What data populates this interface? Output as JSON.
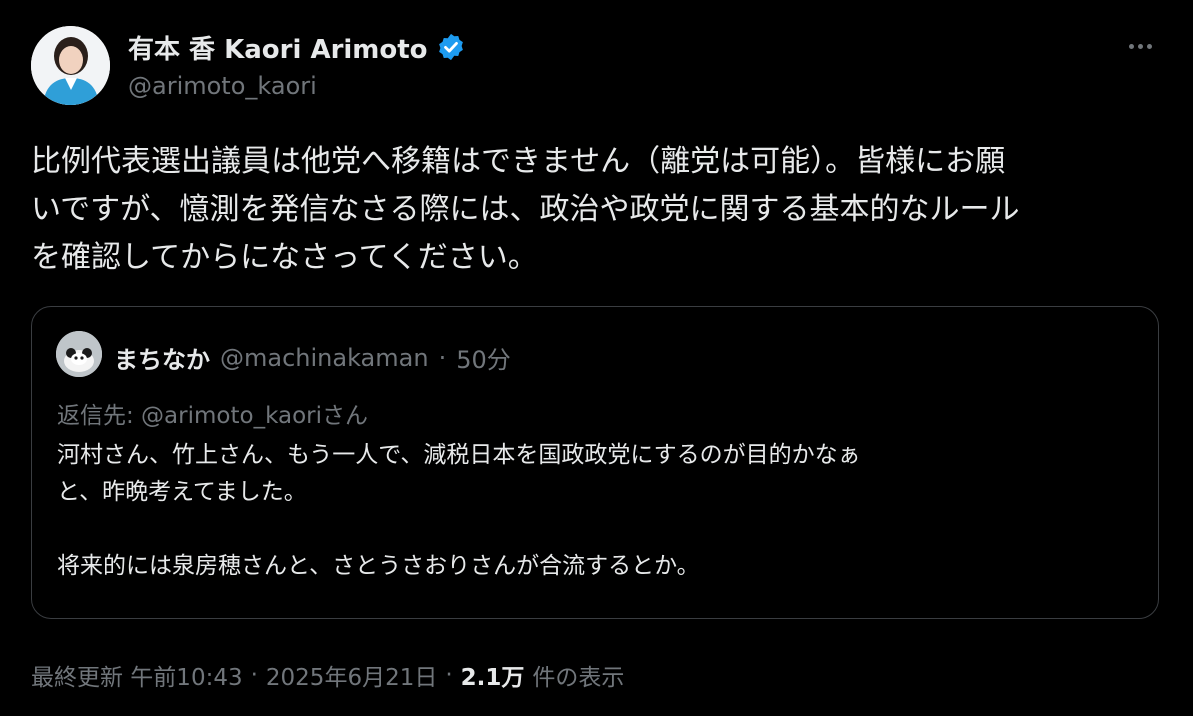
{
  "author": {
    "display_name": "有本 香 Kaori Arimoto",
    "handle": "@arimoto_kaori",
    "verified_icon": "verified-badge-icon",
    "badge_color": "#1d9bf0"
  },
  "post": {
    "text": "比例代表選出議員は他党へ移籍はできません（離党は可能）。皆様にお願\nいですが、憶測を発信なさる際には、政治や政党に関する基本的なルール\nを確認してからになさってください。"
  },
  "quoted_post": {
    "display_name": "まちなか",
    "handle": "@machinakaman",
    "separator": "·",
    "time": "50分",
    "reply_to": "返信先: @arimoto_kaoriさん",
    "text": "河村さん、竹上さん、もう一人で、減税日本を国政政党にするのが目的かなぁ\nと、昨晩考えてました。\n\n将来的には泉房穂さんと、さとうさおりさんが合流するとか。"
  },
  "meta": {
    "updated_label": "最終更新 午前10:43",
    "separator": "·",
    "date": "2025年6月21日",
    "views_count": "2.1万",
    "views_label": "件の表示"
  }
}
